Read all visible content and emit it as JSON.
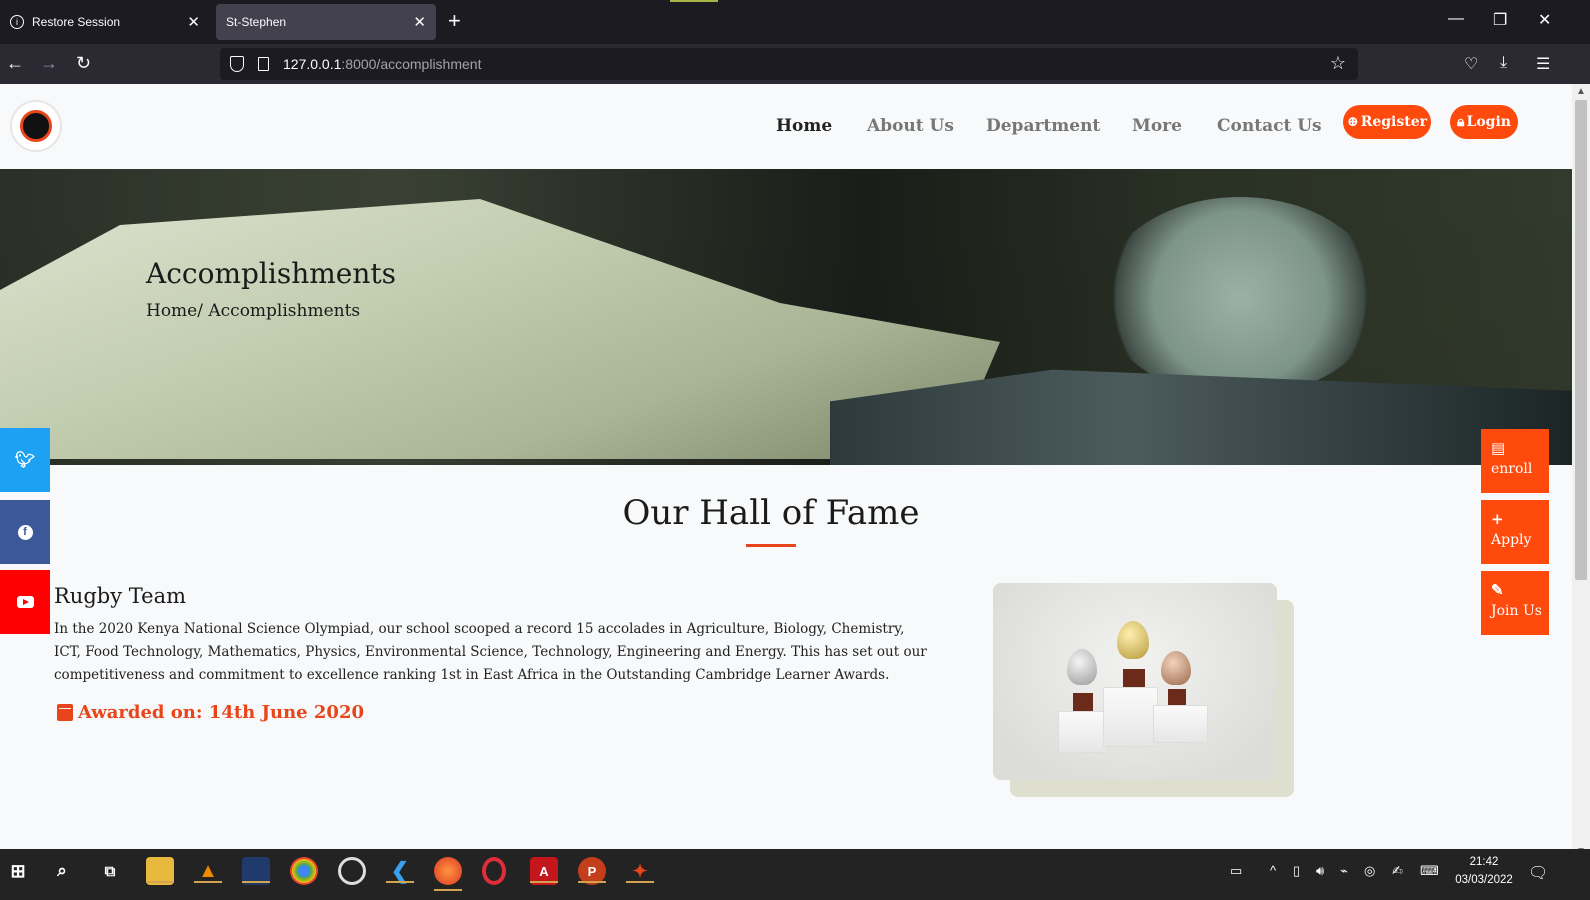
{
  "browser": {
    "tabs": [
      {
        "label": "Restore Session",
        "icon": "info-icon"
      },
      {
        "label": "St-Stephen",
        "icon": ""
      }
    ],
    "url_host": "127.0.0.1",
    "url_path": ":8000/accomplishment"
  },
  "site": {
    "nav": [
      "Home",
      "About Us",
      "Department",
      "More",
      "Contact Us"
    ],
    "register_label": "Register",
    "login_label": "Login"
  },
  "hero": {
    "title": "Accomplishments",
    "breadcrumb": "Home/ Accomplishments"
  },
  "section": {
    "title": "Our Hall of Fame"
  },
  "accomplishment": {
    "team": "Rugby Team",
    "description": "In the 2020 Kenya National Science Olympiad, our school scooped a record 15 accolades in Agriculture, Biology, Chemistry, ICT, Food Technology, Mathematics, Physics, Environmental Science, Technology, Engineering and Energy. This has set out our competitiveness and commitment to excellence ranking 1st in East Africa in the Outstanding Cambridge Learner Awards.",
    "awarded": "Awarded on: 14th June 2020"
  },
  "float_buttons": [
    "enroll",
    "Apply",
    "Join Us"
  ],
  "taskbar": {
    "time": "21:42",
    "date": "03/03/2022"
  },
  "colors": {
    "accent": "#ff4a0e",
    "twitter": "#1da1f2",
    "facebook": "#3b5998",
    "youtube": "#ff0000"
  }
}
